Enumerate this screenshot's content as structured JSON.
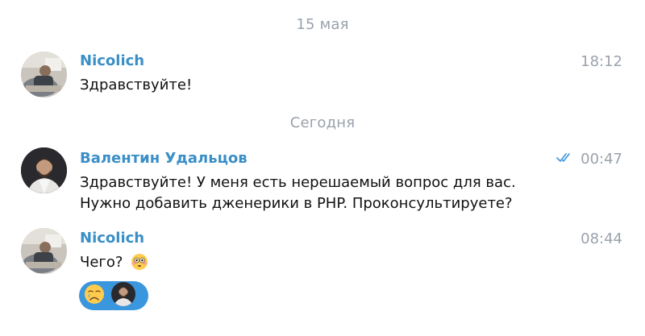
{
  "dates": {
    "first": "15 мая",
    "second": "Сегодня"
  },
  "messages": [
    {
      "sender": "Nicolich",
      "time": "18:12",
      "lines": [
        "Здравствуйте!"
      ]
    },
    {
      "sender": "Валентин Удальцов",
      "time": "00:47",
      "read_status": "double-check-icon",
      "lines": [
        "Здравствуйте! У меня есть нерешаемый вопрос для вас.",
        "Нужно добавить дженерики в PHP. Проконсультируете?"
      ]
    },
    {
      "sender": "Nicolich",
      "time": "08:44",
      "lines": [
        "Чего?"
      ],
      "inline_emoji": "flushed-face-emoji",
      "reaction": {
        "emoji": "crying-face-emoji",
        "reactor": "reactor-avatar"
      }
    }
  ],
  "colors": {
    "sender": "#3a8fc7",
    "muted": "#9aa2ab",
    "text": "#111111",
    "reaction_bg": "#3a96dd",
    "check": "#4a9be0"
  }
}
